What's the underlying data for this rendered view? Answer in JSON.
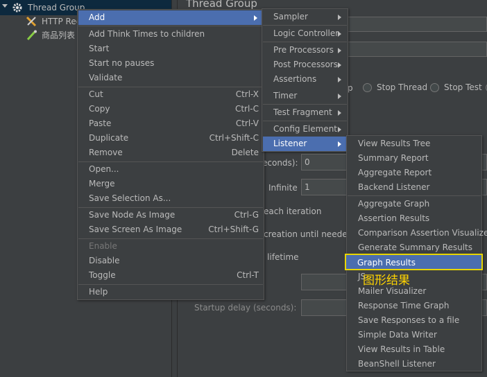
{
  "tree": {
    "thread_group": "Thread Group",
    "http_request": "HTTP Req",
    "product_list": "商品列表"
  },
  "panel": {
    "title": "Thread Group",
    "stop_thread": "Stop Thread",
    "stop_test": "Stop Test",
    "stop_partial": "p",
    "seconds_label": "econds):",
    "ramp_value": "0",
    "infinite_label": "Infinite",
    "loop_value": "1",
    "each_iteration": "each iteration",
    "creation_needed": "creation until needed",
    "lifetime": "l lifetime",
    "startup_delay": "Startup delay (seconds):"
  },
  "context_menu": {
    "items": [
      {
        "label": "Add",
        "shortcut": "",
        "submenu": true
      },
      {
        "label": "Add Think Times to children",
        "shortcut": ""
      },
      {
        "label": "Start",
        "shortcut": ""
      },
      {
        "label": "Start no pauses",
        "shortcut": ""
      },
      {
        "label": "Validate",
        "shortcut": ""
      },
      {
        "label": "Cut",
        "shortcut": "Ctrl-X"
      },
      {
        "label": "Copy",
        "shortcut": "Ctrl-C"
      },
      {
        "label": "Paste",
        "shortcut": "Ctrl-V"
      },
      {
        "label": "Duplicate",
        "shortcut": "Ctrl+Shift-C"
      },
      {
        "label": "Remove",
        "shortcut": "Delete"
      },
      {
        "label": "Open...",
        "shortcut": ""
      },
      {
        "label": "Merge",
        "shortcut": ""
      },
      {
        "label": "Save Selection As...",
        "shortcut": ""
      },
      {
        "label": "Save Node As Image",
        "shortcut": "Ctrl-G"
      },
      {
        "label": "Save Screen As Image",
        "shortcut": "Ctrl+Shift-G"
      },
      {
        "label": "Enable",
        "shortcut": ""
      },
      {
        "label": "Disable",
        "shortcut": ""
      },
      {
        "label": "Toggle",
        "shortcut": "Ctrl-T"
      },
      {
        "label": "Help",
        "shortcut": ""
      }
    ]
  },
  "add_menu": {
    "items": [
      {
        "label": "Sampler"
      },
      {
        "label": "Logic Controller"
      },
      {
        "label": "Pre Processors"
      },
      {
        "label": "Post Processors"
      },
      {
        "label": "Assertions"
      },
      {
        "label": "Timer"
      },
      {
        "label": "Test Fragment"
      },
      {
        "label": "Config Element"
      },
      {
        "label": "Listener"
      }
    ]
  },
  "listener_menu": {
    "items": [
      {
        "label": "View Results Tree"
      },
      {
        "label": "Summary Report"
      },
      {
        "label": "Aggregate Report"
      },
      {
        "label": "Backend Listener"
      },
      {
        "label": "Aggregate Graph"
      },
      {
        "label": "Assertion Results"
      },
      {
        "label": "Comparison Assertion Visualizer"
      },
      {
        "label": "Generate Summary Results"
      },
      {
        "label": "Graph Results"
      },
      {
        "label": "JS"
      },
      {
        "label": "Mailer Visualizer"
      },
      {
        "label": "Response Time Graph"
      },
      {
        "label": "Save Responses to a file"
      },
      {
        "label": "Simple Data Writer"
      },
      {
        "label": "View Results in Table"
      },
      {
        "label": "BeanShell Listener"
      }
    ]
  },
  "annotation": "图形结果",
  "colors": {
    "highlight": "#4b6eaf",
    "annotation": "#ffd400",
    "background": "#3c3f41"
  }
}
